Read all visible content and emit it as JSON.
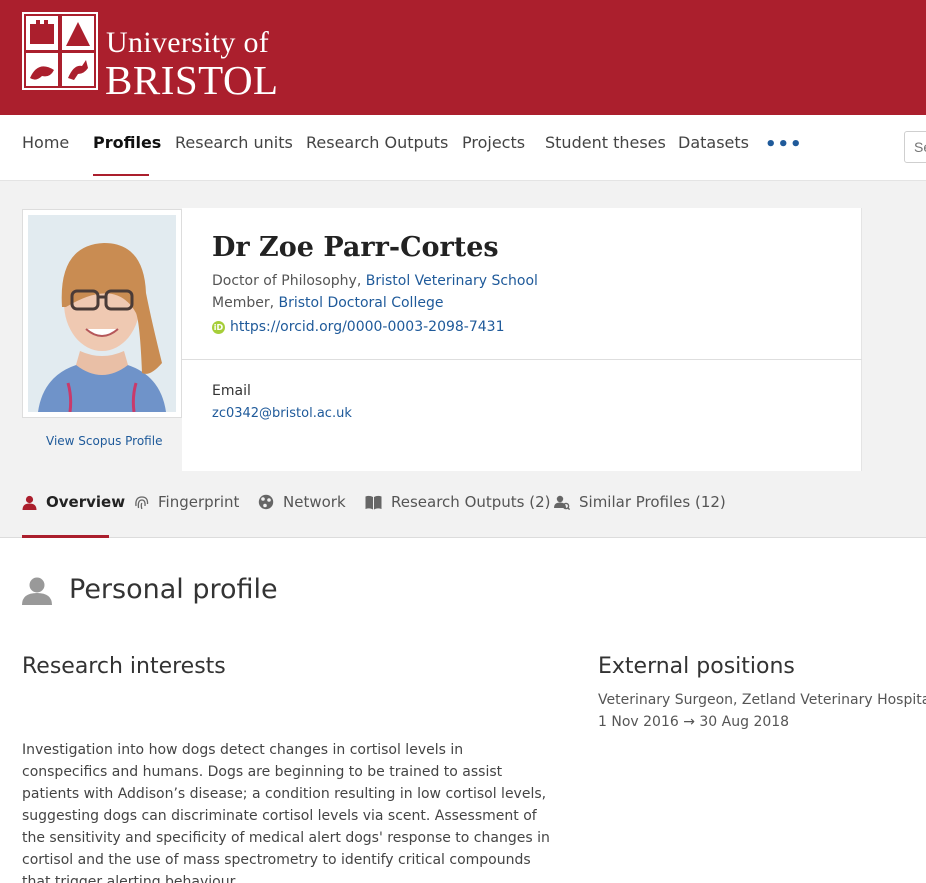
{
  "brand": {
    "line1": "University of",
    "line2": "BRISTOL",
    "color": "#ab1f2d"
  },
  "nav": {
    "items": [
      {
        "label": "Home",
        "active": false
      },
      {
        "label": "Profiles",
        "active": true
      },
      {
        "label": "Research units",
        "active": false
      },
      {
        "label": "Research Outputs",
        "active": false
      },
      {
        "label": "Projects",
        "active": false
      },
      {
        "label": "Student theses",
        "active": false
      },
      {
        "label": "Datasets",
        "active": false
      }
    ],
    "more_label": "•••",
    "search_placeholder": "Se"
  },
  "profile": {
    "name": "Dr Zoe Parr-Cortes",
    "affiliations": [
      {
        "role": "Doctor of Philosophy, ",
        "org": "Bristol Veterinary School"
      },
      {
        "role": "Member, ",
        "org": "Bristol Doctoral College"
      }
    ],
    "orcid_icon": "orcid-icon",
    "orcid": "https://orcid.org/0000-0003-2098-7431",
    "email_label": "Email",
    "email": "zc0342@bristol.ac.uk",
    "scopus_link": "View Scopus Profile"
  },
  "tabs": [
    {
      "label": "Overview",
      "icon": "person-icon",
      "active": true
    },
    {
      "label": "Fingerprint",
      "icon": "fingerprint-icon",
      "active": false
    },
    {
      "label": "Network",
      "icon": "network-icon",
      "active": false
    },
    {
      "label": "Research Outputs (2)",
      "icon": "book-icon",
      "active": false
    },
    {
      "label": "Similar Profiles (12)",
      "icon": "similar-profiles-icon",
      "active": false
    }
  ],
  "content": {
    "section_title": "Personal profile",
    "research_heading": "Research interests",
    "research_text": "Investigation into how dogs detect changes in cortisol levels in conspecifics and humans. Dogs are beginning to be trained to assist patients with Addison’s disease; a condition resulting in low cortisol levels, suggesting dogs can discriminate cortisol levels via scent. Assessment of the sensitivity and specificity of medical alert dogs' response to changes in cortisol and the use of mass spectrometry to identify critical compounds that trigger alerting behaviour.",
    "external_heading": "External positions",
    "external_position": "Veterinary Surgeon, Zetland Veterinary Hospital",
    "external_dates": "1 Nov 2016 → 30 Aug 2018"
  }
}
